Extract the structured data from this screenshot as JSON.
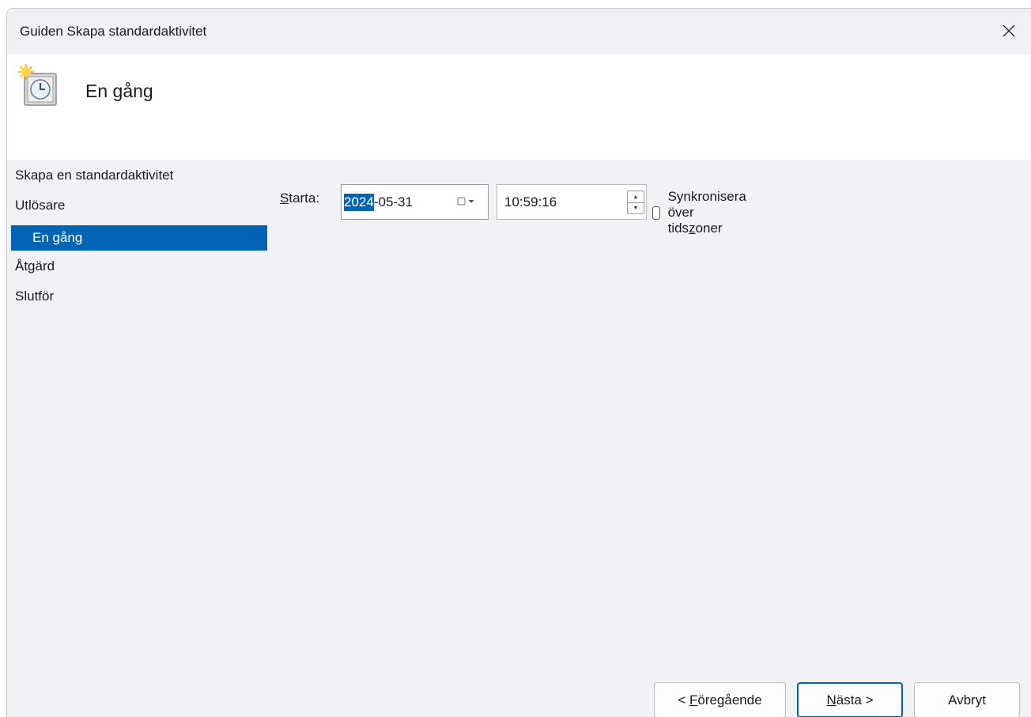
{
  "window": {
    "title": "Guiden Skapa standardaktivitet"
  },
  "header": {
    "title": "En gång",
    "icon": "scheduled-task-clock-icon"
  },
  "nav": {
    "items": [
      {
        "label": "Skapa en standardaktivitet",
        "selected": false
      },
      {
        "label": "Utlösare",
        "selected": false
      },
      {
        "label": "En gång",
        "selected": true
      },
      {
        "label": "Åtgärd",
        "selected": false
      },
      {
        "label": "Slutför",
        "selected": false
      }
    ]
  },
  "start": {
    "label_mnemonic": "S",
    "label_rest": "tarta:",
    "date_selected": "2024",
    "date_rest": "-05-31",
    "time": "10:59:16"
  },
  "sync": {
    "label_before": "Synkronisera över tids",
    "label_mnemonic": "z",
    "label_after": "oner",
    "checked": false
  },
  "buttons": {
    "prev_before": "< ",
    "prev_mnemonic": "F",
    "prev_after": "öregående",
    "next_mnemonic": "N",
    "next_after": "ästa >",
    "cancel": "Avbryt"
  },
  "colors": {
    "selection": "#0064b4",
    "window_bg": "#f0f2f5"
  }
}
